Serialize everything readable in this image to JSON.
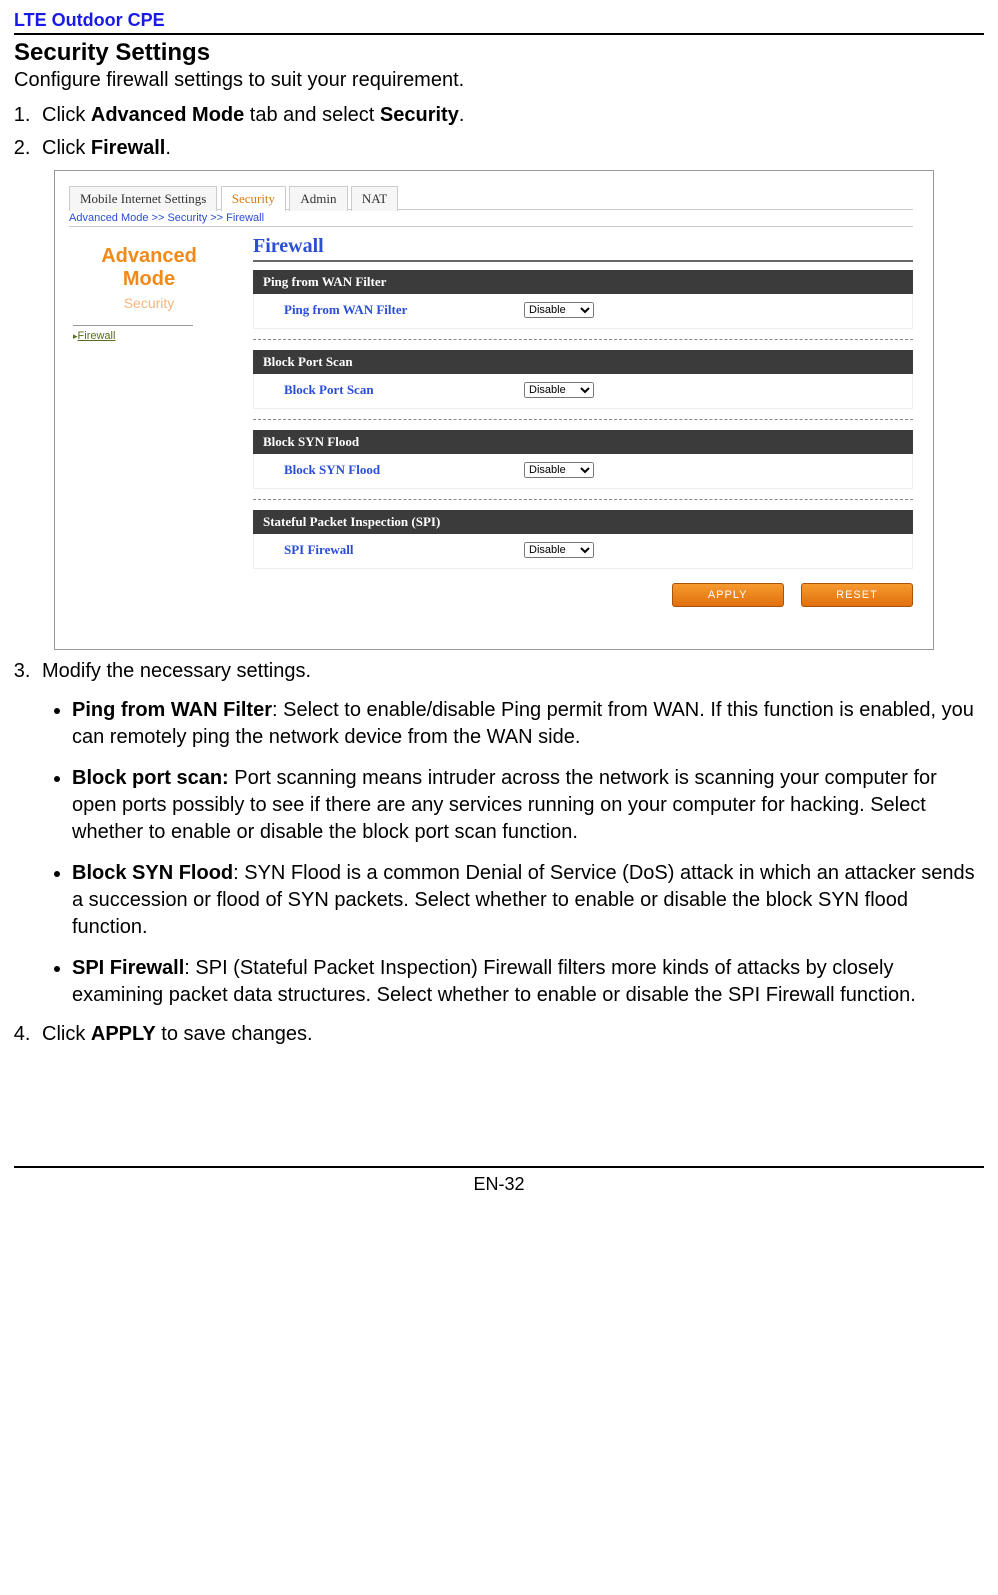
{
  "doc": {
    "header": "LTE Outdoor CPE",
    "section_title": "Security Settings",
    "subtitle": "Configure firewall settings to suit your requirement.",
    "step1_pre": "Click ",
    "step1_b1": "Advanced Mode",
    "step1_mid": " tab and select ",
    "step1_b2": "Security",
    "step1_post": ".",
    "step2_pre": "Click ",
    "step2_b": "Firewall",
    "step2_post": ".",
    "step3": "Modify the necessary settings.",
    "bullets": [
      {
        "b": "Ping from WAN Filter",
        "sep": ": ",
        "t": "Select to enable/disable Ping permit from WAN. If this function is enabled, you can remotely ping the network device from the WAN side."
      },
      {
        "b": "Block port scan:",
        "sep": " ",
        "t": "Port scanning means intruder across the network is scanning your computer for open ports possibly to see if there are any services running on your computer for hacking. Select whether to enable or disable the block port scan function."
      },
      {
        "b": "Block SYN Flood",
        "sep": ": ",
        "t": "SYN Flood is a common Denial of Service (DoS) attack in which an attacker sends a succession or flood of SYN packets. Select whether to enable or disable the block SYN flood function."
      },
      {
        "b": "SPI Firewall",
        "sep": ": ",
        "t": "SPI (Stateful Packet Inspection) Firewall filters more kinds of attacks by closely examining packet data structures. Select whether to enable or disable the SPI Firewall function."
      }
    ],
    "step4_pre": "Click ",
    "step4_b": "APPLY",
    "step4_post": " to save changes.",
    "page_no": "EN-32"
  },
  "ui": {
    "tabs": [
      "Mobile Internet Settings",
      "Security",
      "Admin",
      "NAT"
    ],
    "active_tab_index": 1,
    "breadcrumb": "Advanced Mode >> Security >> Firewall",
    "sidebar": {
      "adv": "Advanced",
      "mode": "Mode",
      "sec": "Security",
      "fw": "Firewall"
    },
    "panel_title": "Firewall",
    "groups": [
      {
        "header": "Ping from WAN Filter",
        "label": "Ping from WAN Filter",
        "value": "Disable"
      },
      {
        "header": "Block Port Scan",
        "label": "Block Port Scan",
        "value": "Disable"
      },
      {
        "header": "Block SYN Flood",
        "label": "Block SYN Flood",
        "value": "Disable"
      },
      {
        "header": "Stateful Packet Inspection (SPI)",
        "label": "SPI Firewall",
        "value": "Disable"
      }
    ],
    "apply": "APPLY",
    "reset": "RESET"
  }
}
